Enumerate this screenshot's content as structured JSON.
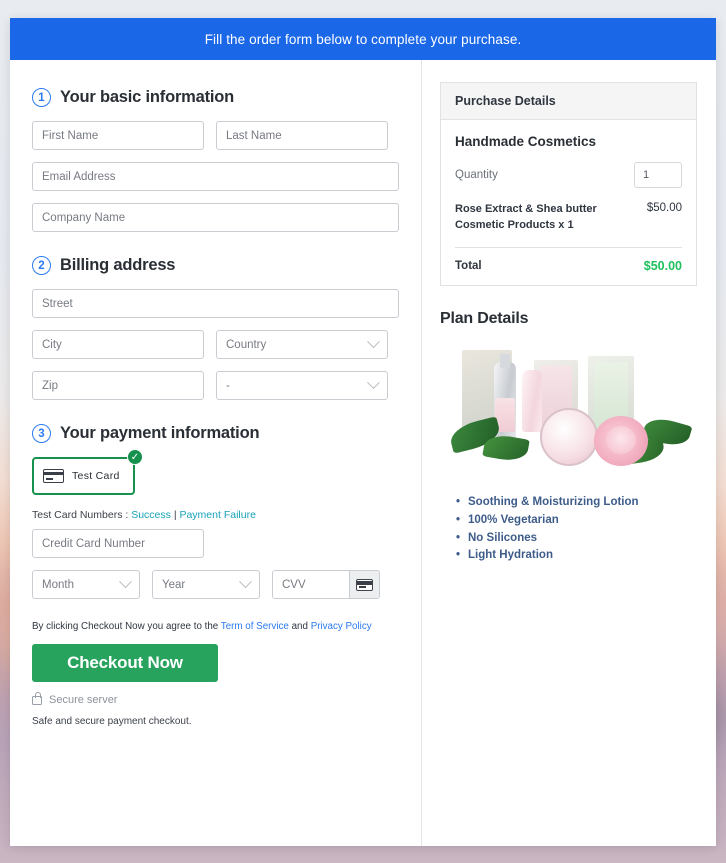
{
  "banner": {
    "text": "Fill the order form below to complete your purchase."
  },
  "colors": {
    "banner_blue": "#1a67e8",
    "step_blue": "#2b7bf0",
    "checkout_green": "#27a35e",
    "testcard_green": "#17914e",
    "total_green": "#20c05e",
    "teal_link": "#17a2b8",
    "bullet_blue": "#3e5c8a"
  },
  "sections": {
    "basic": {
      "number": "1",
      "title": "Your basic information",
      "fields": {
        "first_name": "First Name",
        "last_name": "Last Name",
        "email": "Email Address",
        "company": "Company Name"
      }
    },
    "billing": {
      "number": "2",
      "title": "Billing address",
      "fields": {
        "street": "Street",
        "city": "City",
        "country": "Country",
        "zip": "Zip",
        "state": "-"
      }
    },
    "payment": {
      "number": "3",
      "title": "Your payment information",
      "method": {
        "label": "Test Card",
        "icon": "credit-card-icon",
        "selected_icon": "check-circle-icon",
        "selected_mark": "✓"
      },
      "test_numbers": {
        "prefix": "Test Card Numbers :",
        "success": "Success",
        "separator": "|",
        "failure": "Payment Failure"
      },
      "fields": {
        "card_number": "Credit Card Number",
        "month": "Month",
        "year": "Year",
        "cvv": "CVV"
      }
    }
  },
  "footer": {
    "terms_prefix": "By clicking Checkout Now you agree to the",
    "terms_link": "Term of Service",
    "terms_and": "and",
    "privacy_link": "Privacy Policy",
    "checkout_label": "Checkout Now",
    "secure_label": "Secure server",
    "safe_note": "Safe and secure payment checkout."
  },
  "purchase": {
    "heading": "Purchase Details",
    "product_title": "Handmade Cosmetics",
    "quantity_label": "Quantity",
    "quantity_value": "1",
    "line_description": "Rose Extract & Shea butter Cosmetic Products x 1",
    "line_price": "$50.00",
    "total_label": "Total",
    "total_value": "$50.00"
  },
  "plan": {
    "heading": "Plan Details",
    "image_alt": "handmade rose cosmetics product set with pink rose and green leaves",
    "features": [
      "Soothing & Moisturizing Lotion",
      "100% Vegetarian",
      "No Silicones",
      "Light Hydration"
    ]
  }
}
